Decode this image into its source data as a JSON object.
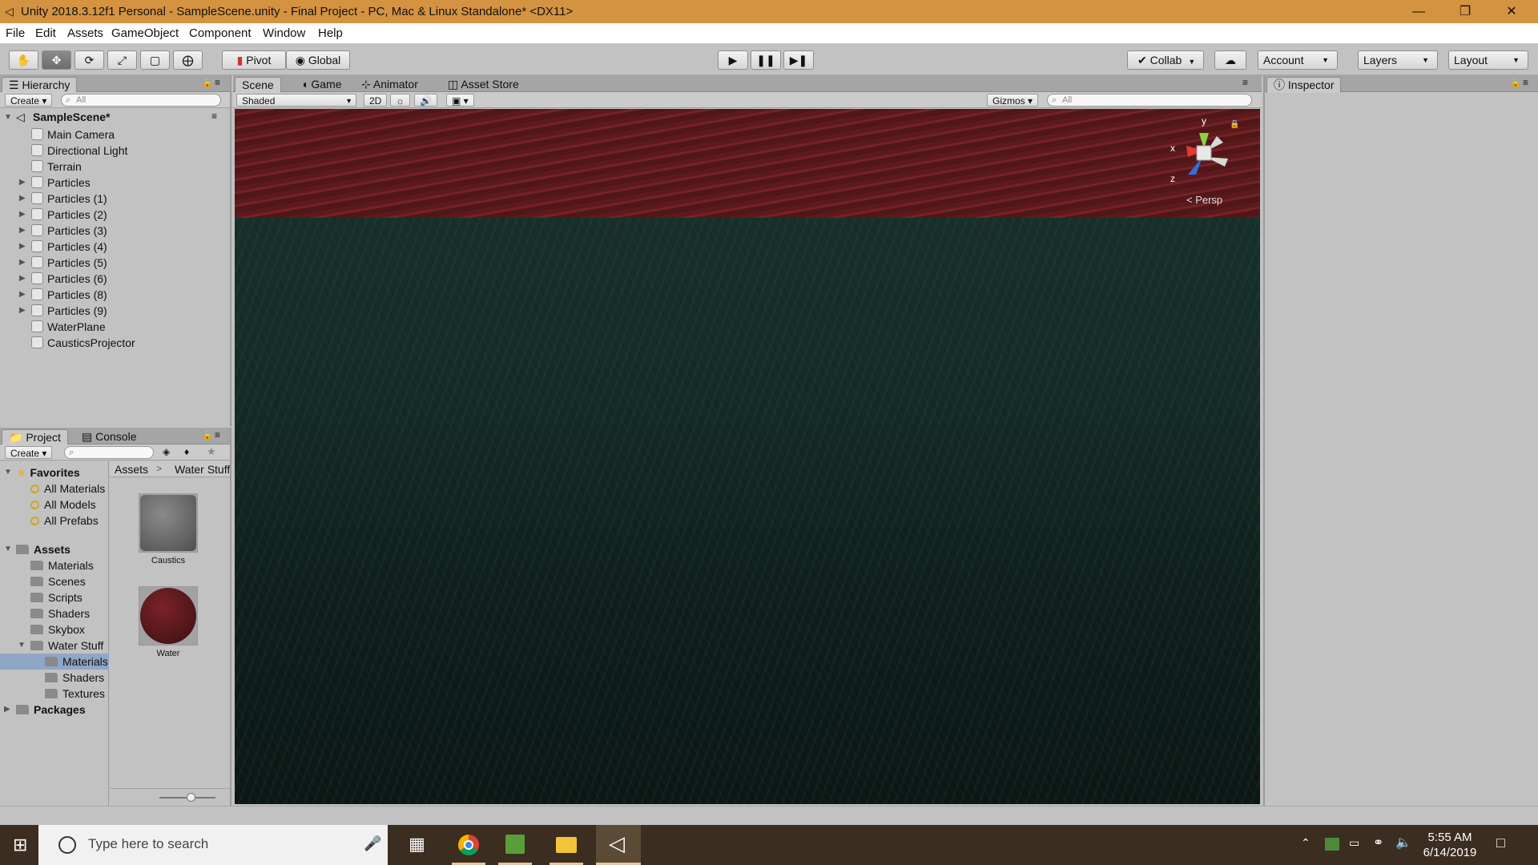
{
  "window": {
    "title": "Unity 2018.3.12f1 Personal - SampleScene.unity - Final Project - PC, Mac & Linux Standalone* <DX11>",
    "minimize": "—",
    "maximize": "❐",
    "close": "✕"
  },
  "menu": [
    "File",
    "Edit",
    "Assets",
    "GameObject",
    "Component",
    "Window",
    "Help"
  ],
  "toolbar": {
    "tools": [
      "hand-tool",
      "move-tool",
      "rotate-tool",
      "scale-tool",
      "rect-tool",
      "transform-tool"
    ],
    "pivot": "Pivot",
    "global": "Global",
    "collab": "Collab",
    "account": "Account",
    "layers": "Layers",
    "layout": "Layout"
  },
  "hierarchy": {
    "tab": "Hierarchy",
    "create": "Create",
    "search_placeholder": "All",
    "scene": "SampleScene*",
    "items": [
      {
        "label": "Main Camera",
        "expandable": false
      },
      {
        "label": "Directional Light",
        "expandable": false
      },
      {
        "label": "Terrain",
        "expandable": false
      },
      {
        "label": "Particles",
        "expandable": true
      },
      {
        "label": "Particles (1)",
        "expandable": true
      },
      {
        "label": "Particles (2)",
        "expandable": true
      },
      {
        "label": "Particles (3)",
        "expandable": true
      },
      {
        "label": "Particles (4)",
        "expandable": true
      },
      {
        "label": "Particles (5)",
        "expandable": true
      },
      {
        "label": "Particles (6)",
        "expandable": true
      },
      {
        "label": "Particles (8)",
        "expandable": true
      },
      {
        "label": "Particles (9)",
        "expandable": true
      },
      {
        "label": "WaterPlane",
        "expandable": false
      },
      {
        "label": "CausticsProjector",
        "expandable": false
      }
    ]
  },
  "scene": {
    "tabs": [
      "Scene",
      "Game",
      "Animator",
      "Asset Store"
    ],
    "shading": "Shaded",
    "mode_2d": "2D",
    "gizmos": "Gizmos",
    "search_placeholder": "All",
    "persp": "< Persp",
    "axis_x": "x",
    "axis_y": "y",
    "axis_z": "z"
  },
  "inspector": {
    "tab": "Inspector"
  },
  "project": {
    "tabs": [
      "Project",
      "Console"
    ],
    "create": "Create",
    "favorites": {
      "label": "Favorites",
      "items": [
        "All Materials",
        "All Models",
        "All Prefabs"
      ]
    },
    "assets": {
      "label": "Assets",
      "folders": [
        "Materials",
        "Scenes",
        "Scripts",
        "Shaders",
        "Skybox",
        "Water Stuff"
      ],
      "water_children": [
        "Materials",
        "Shaders",
        "Textures"
      ]
    },
    "packages": "Packages",
    "breadcrumb": [
      "Assets",
      "Water Stuff"
    ],
    "breadcrumb_sep": ">",
    "thumbnails": [
      {
        "label": "Caustics",
        "color": "#6e6e6e"
      },
      {
        "label": "Water",
        "color": "#5a1a1e"
      }
    ]
  },
  "taskbar": {
    "search_placeholder": "Type here to search",
    "time": "5:55 AM",
    "date": "6/14/2019"
  }
}
